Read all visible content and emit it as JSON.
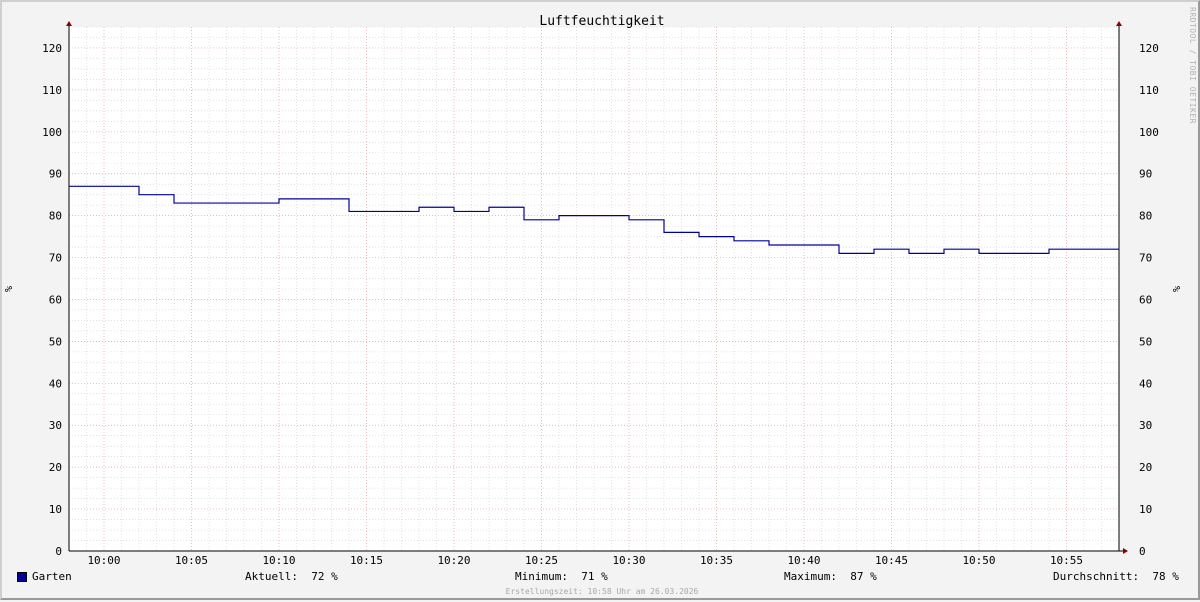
{
  "chart_data": {
    "type": "line",
    "title": "Luftfeuchtigkeit",
    "ylabel": "%",
    "ylim": [
      0,
      125
    ],
    "y_ticks": [
      0,
      10,
      20,
      30,
      40,
      50,
      60,
      70,
      80,
      90,
      100,
      110,
      120
    ],
    "x_range": [
      "09:58",
      "10:58"
    ],
    "x_ticks": [
      "10:00",
      "10:05",
      "10:10",
      "10:15",
      "10:20",
      "10:25",
      "10:30",
      "10:35",
      "10:40",
      "10:45",
      "10:50",
      "10:55"
    ],
    "grid": true,
    "step": true,
    "series": [
      {
        "name": "Garten",
        "color": "#00009c",
        "x": [
          "09:58",
          "10:02",
          "10:04",
          "10:10",
          "10:14",
          "10:18",
          "10:20",
          "10:22",
          "10:24",
          "10:26",
          "10:30",
          "10:32",
          "10:34",
          "10:36",
          "10:38",
          "10:42",
          "10:44",
          "10:46",
          "10:48",
          "10:50",
          "10:54",
          "10:58"
        ],
        "values": [
          87,
          85,
          83,
          84,
          81,
          82,
          81,
          82,
          79,
          80,
          79,
          76,
          75,
          74,
          73,
          71,
          72,
          71,
          72,
          71,
          72,
          72
        ]
      }
    ]
  },
  "legend": {
    "series_name": "Garten",
    "current": "Aktuell:  72 %",
    "minimum": "Minimum:  71 %",
    "maximum": "Maximum:  87 %",
    "average": "Durchschnitt:  78 %"
  },
  "footer": "Erstellungszeit: 10:58 Uhr am 26.03.2026",
  "watermark": "RRDTOOL / TOBI OETIKER",
  "colors": {
    "line": "#00009c",
    "major_grid": "#e8a0a0",
    "minor_grid": "#d0d0d0",
    "axis": "#000000",
    "arrow": "#8b0000"
  }
}
